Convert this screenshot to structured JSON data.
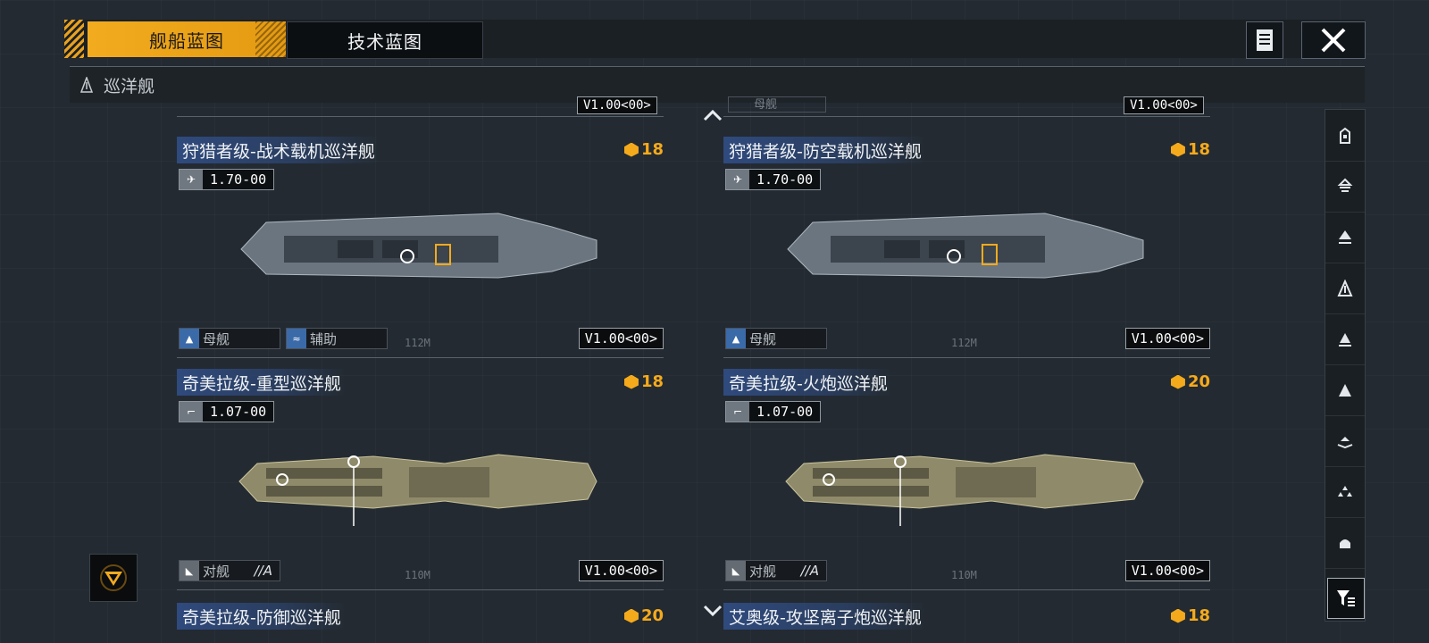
{
  "tabs": [
    {
      "label": "舰船蓝图",
      "active": true
    },
    {
      "label": "技术蓝图",
      "active": false
    }
  ],
  "category": {
    "label": "巡洋舰",
    "icon": "cruiser-icon"
  },
  "top_partial": {
    "left_ver": "V1.00<00>",
    "right_ver": "V1.00<00>",
    "right_tag": "母舰"
  },
  "cards": [
    {
      "title": "狩猎者级-战术载机巡洋舰",
      "cost": "18",
      "stat": "1.70-00",
      "stat_icon": "aircraft-icon",
      "tags": [
        {
          "label": "母舰",
          "icon": "carrier-icon",
          "suffix": ""
        },
        {
          "label": "辅助",
          "icon": "support-icon",
          "suffix": ""
        }
      ],
      "range": "112M",
      "version": "V1.00<00>"
    },
    {
      "title": "狩猎者级-防空载机巡洋舰",
      "cost": "18",
      "stat": "1.70-00",
      "stat_icon": "aircraft-icon",
      "tags": [
        {
          "label": "母舰",
          "icon": "carrier-icon",
          "suffix": ""
        }
      ],
      "range": "112M",
      "version": "V1.00<00>"
    },
    {
      "title": "奇美拉级-重型巡洋舰",
      "cost": "18",
      "stat": "1.07-00",
      "stat_icon": "cannon-icon",
      "tags": [
        {
          "label": "对舰",
          "icon": "anti-ship-icon",
          "suffix": "//A"
        }
      ],
      "range": "110M",
      "version": "V1.00<00>"
    },
    {
      "title": "奇美拉级-火炮巡洋舰",
      "cost": "20",
      "stat": "1.07-00",
      "stat_icon": "cannon-icon",
      "tags": [
        {
          "label": "对舰",
          "icon": "anti-ship-icon",
          "suffix": "//A"
        }
      ],
      "range": "110M",
      "version": "V1.00<00>"
    }
  ],
  "bottom_partial": [
    {
      "title": "奇美拉级-防御巡洋舰",
      "cost": "20"
    },
    {
      "title": "艾奥级-攻坚离子炮巡洋舰",
      "cost": "18"
    }
  ],
  "rail_icons": [
    "frigate-icon",
    "destroyer-icon",
    "cruiser-class-icon",
    "cruiser-icon",
    "battlecruiser-icon",
    "battleship-icon",
    "carrier-icon",
    "auxiliary-icon",
    "station-icon"
  ],
  "colors": {
    "accent": "#f2ab1e",
    "title_bg": "#2f4a7d",
    "background": "#232a31"
  }
}
